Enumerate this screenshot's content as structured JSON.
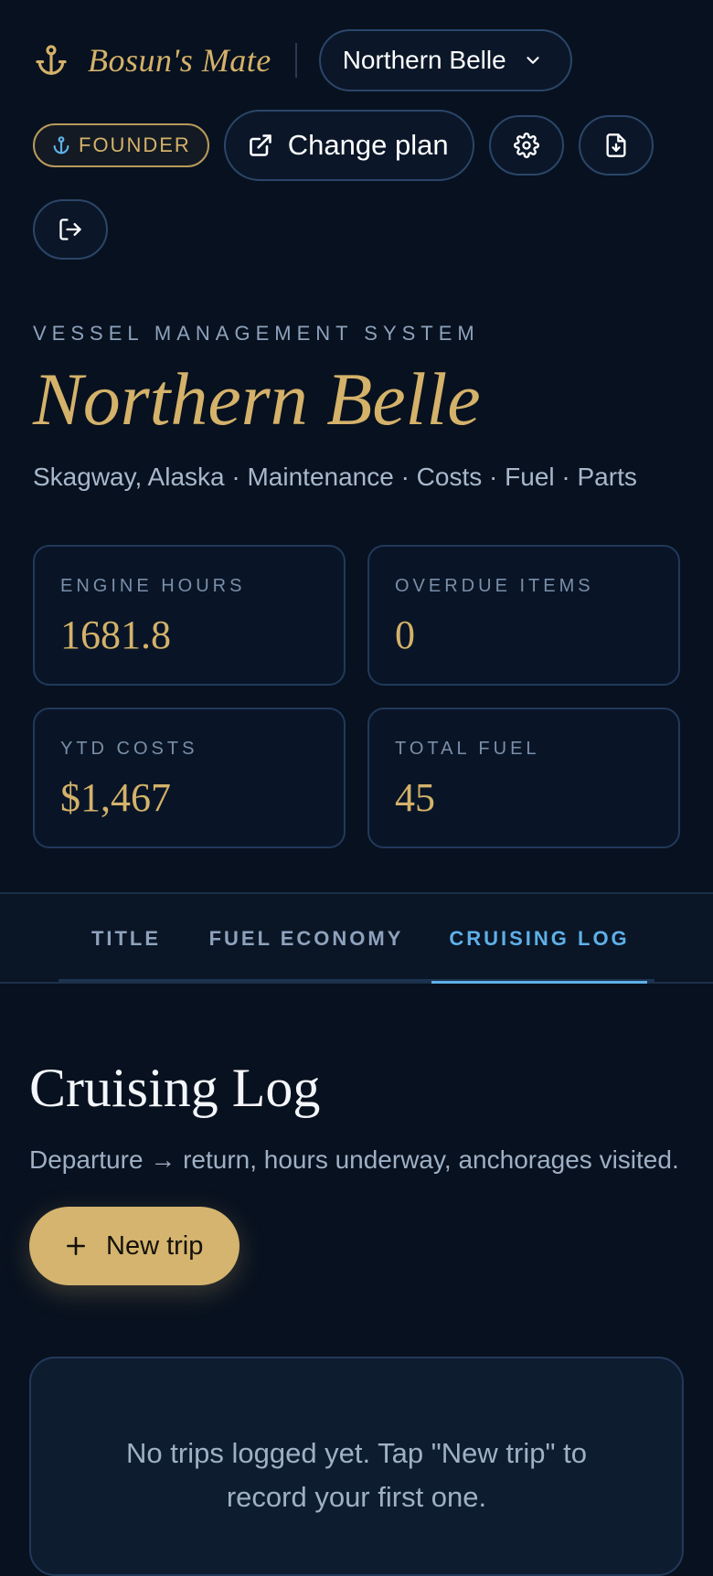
{
  "header": {
    "brand": "Bosun's Mate",
    "vessel_selector": "Northern Belle",
    "badge": "FOUNDER",
    "change_plan": "Change plan"
  },
  "hero": {
    "eyebrow": "VESSEL MANAGEMENT SYSTEM",
    "title": "Northern Belle",
    "subtitle": "Skagway, Alaska · Maintenance · Costs · Fuel · Parts"
  },
  "stats": [
    {
      "label": "ENGINE HOURS",
      "value": "1681.8"
    },
    {
      "label": "OVERDUE ITEMS",
      "value": "0"
    },
    {
      "label": "YTD COSTS",
      "value": "$1,467"
    },
    {
      "label": "TOTAL FUEL",
      "value": "45"
    }
  ],
  "tabs": [
    {
      "label": "TITLE",
      "active": false
    },
    {
      "label": "FUEL ECONOMY",
      "active": false
    },
    {
      "label": "CRUISING LOG",
      "active": true
    }
  ],
  "section": {
    "title": "Cruising Log",
    "description": "Departure → return, hours underway, anchorages visited.",
    "new_trip_label": "New trip",
    "empty_message": "No trips logged yet. Tap \"New trip\" to record your first one."
  },
  "colors": {
    "background": "#08111f",
    "accent_gold": "#d4b26a",
    "active_tab": "#5eb0e8"
  },
  "icons": [
    "anchor-icon",
    "chevron-down-icon",
    "external-link-icon",
    "gear-icon",
    "file-download-icon",
    "logout-icon",
    "plus-icon"
  ]
}
